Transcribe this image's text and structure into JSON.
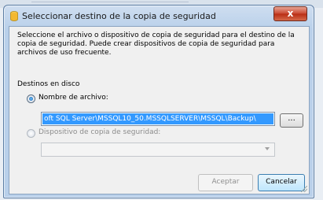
{
  "window": {
    "title": "Seleccionar destino de la copia de seguridad",
    "close_label": "x"
  },
  "description": "Seleccione el archivo o dispositivo de copia de seguridad para el destino de la copia de seguridad. Puede crear dispositivos de copia de seguridad para archivos de uso frecuente.",
  "group_label": "Destinos en disco",
  "file_option": {
    "label": "Nombre de archivo:",
    "selected": true,
    "value": "oft SQL Server\\MSSQL10_50.MSSQLSERVER\\MSSQL\\Backup\\",
    "browse_label": "..."
  },
  "device_option": {
    "label": "Dispositivo de copia de seguridad:",
    "selected": false,
    "value": ""
  },
  "buttons": {
    "accept": "Aceptar",
    "cancel": "Cancelar"
  },
  "colors": {
    "selection": "#3399ff",
    "close": "#c8462f"
  }
}
